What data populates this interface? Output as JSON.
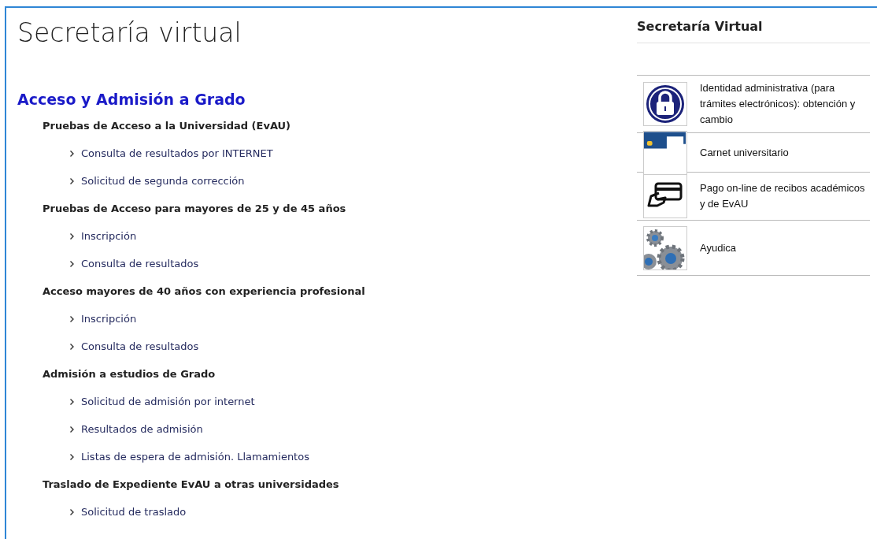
{
  "page_title": "Secretaría virtual",
  "section": {
    "title": "Acceso y Admisión a Grado",
    "groups": [
      {
        "title": "Pruebas de Acceso a la Universidad (EvAU)",
        "links": [
          "Consulta de resultados por INTERNET",
          "Solicitud de segunda corrección"
        ]
      },
      {
        "title": "Pruebas de Acceso para mayores de 25 y de 45 años",
        "links": [
          "Inscripción",
          "Consulta de resultados"
        ]
      },
      {
        "title": "Acceso mayores de 40 años con experiencia profesional",
        "links": [
          "Inscripción",
          "Consulta de resultados"
        ]
      },
      {
        "title": "Admisión a estudios de Grado",
        "links": [
          "Solicitud de admisión por internet",
          "Resultados de admisión",
          "Listas de espera de admisión. Llamamientos"
        ]
      },
      {
        "title": "Traslado de Expediente EvAU a otras universidades",
        "links": [
          "Solicitud de traslado"
        ]
      }
    ]
  },
  "sidebar": {
    "title": "Secretaría Virtual",
    "items": [
      {
        "label": "Identidad administrativa (para trámites electrónicos): obtención y cambio"
      },
      {
        "label": "Carnet universitario"
      },
      {
        "label": "Pago on-line de recibos académicos y de EvAU"
      },
      {
        "label": "Ayudica"
      }
    ]
  }
}
